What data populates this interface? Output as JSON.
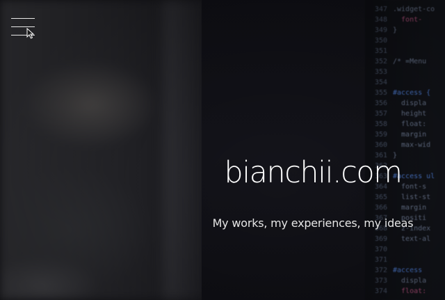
{
  "header": {
    "menu_icon": "hamburger-menu-icon",
    "cursor_icon": "mouse-pointer-icon"
  },
  "hero": {
    "title": "bianchii.com",
    "subtitle": "My works, my experiences, my ideas"
  },
  "background_code": {
    "lines": [
      {
        "num": "347",
        "text": ".widget-co",
        "cls": "c-gray"
      },
      {
        "num": "348",
        "text": "  font-",
        "cls": "c-pink"
      },
      {
        "num": "349",
        "text": "}",
        "cls": "c-gray"
      },
      {
        "num": "350",
        "text": "",
        "cls": "c-gray"
      },
      {
        "num": "351",
        "text": "",
        "cls": "c-gray"
      },
      {
        "num": "352",
        "text": "/* =Menu",
        "cls": "c-gray"
      },
      {
        "num": "353",
        "text": "",
        "cls": "c-gray"
      },
      {
        "num": "354",
        "text": "",
        "cls": "c-gray"
      },
      {
        "num": "355",
        "text": "#access {",
        "cls": "c-blue"
      },
      {
        "num": "356",
        "text": "  displa",
        "cls": "c-gray"
      },
      {
        "num": "357",
        "text": "  height",
        "cls": "c-gray"
      },
      {
        "num": "358",
        "text": "  float:",
        "cls": "c-gray"
      },
      {
        "num": "359",
        "text": "  margin",
        "cls": "c-gray"
      },
      {
        "num": "360",
        "text": "  max-wid",
        "cls": "c-gray"
      },
      {
        "num": "361",
        "text": "}",
        "cls": "c-gray"
      },
      {
        "num": "362",
        "text": "",
        "cls": "c-gray"
      },
      {
        "num": "363",
        "text": "#access ul",
        "cls": "c-blue"
      },
      {
        "num": "364",
        "text": "  font-s",
        "cls": "c-gray"
      },
      {
        "num": "365",
        "text": "  list-st",
        "cls": "c-gray"
      },
      {
        "num": "366",
        "text": "  margin",
        "cls": "c-gray"
      },
      {
        "num": "367",
        "text": "  positi",
        "cls": "c-gray"
      },
      {
        "num": "368",
        "text": "  z-index",
        "cls": "c-gray"
      },
      {
        "num": "369",
        "text": "  text-al",
        "cls": "c-gray"
      },
      {
        "num": "370",
        "text": "",
        "cls": "c-gray"
      },
      {
        "num": "371",
        "text": "",
        "cls": "c-gray"
      },
      {
        "num": "372",
        "text": "#access",
        "cls": "c-blue"
      },
      {
        "num": "373",
        "text": "  displa",
        "cls": "c-gray"
      },
      {
        "num": "374",
        "text": "  float:",
        "cls": "c-pink"
      }
    ]
  },
  "colors": {
    "text": "#ffffff",
    "subtitle": "#e6e6e6",
    "background": "#17171c"
  }
}
